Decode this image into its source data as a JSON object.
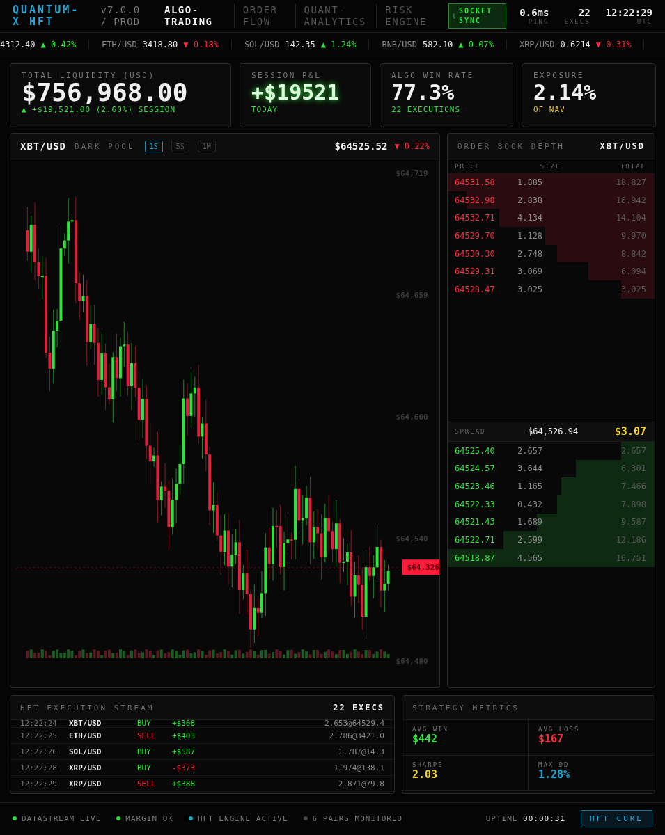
{
  "header": {
    "logo": "QUANTUM-X HFT",
    "version": "v7.0.0 / PROD",
    "tabs": [
      {
        "label": "ALGO-TRADING",
        "selected": true
      },
      {
        "label": "ORDER FLOW",
        "selected": false
      },
      {
        "label": "QUANT-ANALYTICS",
        "selected": false
      },
      {
        "label": "RISK ENGINE",
        "selected": false
      }
    ],
    "sync_button": "SOCKET SYNC",
    "stats": [
      {
        "value": "0.6ms",
        "label": "PING"
      },
      {
        "value": "22",
        "label": "EXECS"
      },
      {
        "value": "12:22:29",
        "label": "UTC"
      }
    ]
  },
  "ticker": [
    {
      "price": "4312.40",
      "change": "▲ 0.42%",
      "kind": "up"
    },
    {
      "pair": "ETH/USD",
      "price": "3418.80",
      "change": "▼ 0.18%",
      "kind": "down"
    },
    {
      "pair": "SOL/USD",
      "price": "142.35",
      "change": "▲ 1.24%",
      "kind": "up"
    },
    {
      "pair": "BNB/USD",
      "price": "582.10",
      "change": "▲ 0.07%",
      "kind": "up"
    },
    {
      "pair": "XRP/USD",
      "price": "0.6214",
      "change": "▼ 0.31%",
      "kind": "down"
    }
  ],
  "stat_cards": [
    {
      "label": "TOTAL LIQUIDITY (USD)",
      "value": "$756,968.00",
      "sub": "▲ +$19,521.00 (2.60%) SESSION",
      "color": "#2ee43a",
      "glow": false
    },
    {
      "label": "SESSION P&L",
      "value": "+$19521",
      "sub": "TODAY",
      "color": "#2ee43a",
      "glow": true
    },
    {
      "label": "ALGO WIN RATE",
      "value": "77.3%",
      "sub": "22 EXECUTIONS",
      "color": "#2ee43a",
      "glow": false
    },
    {
      "label": "EXPOSURE",
      "value": "2.14%",
      "sub": "OF NAV",
      "color": "#e8c425",
      "glow": false
    }
  ],
  "chart_panel": {
    "pair": "XBT/USD",
    "venue": "DARK POOL",
    "timeframes": [
      {
        "label": "1S",
        "selected": true
      },
      {
        "label": "5S",
        "selected": false
      },
      {
        "label": "1M",
        "selected": false
      }
    ],
    "price": "$64525.52",
    "change": "▼ 0.22%",
    "axis_labels": [
      "$64,719",
      "$64,659",
      "$64,600",
      "$64,540",
      "$64,480"
    ],
    "last_price_tag": "$64,326"
  },
  "order_book": {
    "title": "ORDER BOOK DEPTH",
    "pair": "XBT/USD",
    "columns": [
      "PRICE",
      "SIZE",
      "TOTAL"
    ],
    "asks": [
      {
        "price": "64531.58",
        "size": "1.885",
        "total": "18.827"
      },
      {
        "price": "64532.98",
        "size": "2.838",
        "total": "16.942"
      },
      {
        "price": "64532.71",
        "size": "4.134",
        "total": "14.104"
      },
      {
        "price": "64529.70",
        "size": "1.128",
        "total": "9.970"
      },
      {
        "price": "64530.30",
        "size": "2.748",
        "total": "8.842"
      },
      {
        "price": "64529.31",
        "size": "3.069",
        "total": "6.094"
      },
      {
        "price": "64528.47",
        "size": "3.025",
        "total": "3.025"
      }
    ],
    "spread": {
      "label": "SPREAD",
      "mid": "$64,526.94",
      "value": "$3.07"
    },
    "bids": [
      {
        "price": "64525.40",
        "size": "2.657",
        "total": "2.657"
      },
      {
        "price": "64524.57",
        "size": "3.644",
        "total": "6.301"
      },
      {
        "price": "64523.46",
        "size": "1.165",
        "total": "7.466"
      },
      {
        "price": "64522.33",
        "size": "0.432",
        "total": "7.898"
      },
      {
        "price": "64521.43",
        "size": "1.689",
        "total": "9.587"
      },
      {
        "price": "64522.71",
        "size": "2.599",
        "total": "12.186"
      },
      {
        "price": "64518.87",
        "size": "4.565",
        "total": "16.751"
      }
    ]
  },
  "execution_stream": {
    "title": "HFT EXECUTION STREAM",
    "count": "22 EXECS",
    "rows": [
      {
        "time": "12:22:24",
        "pair": "XBT/USD",
        "side": "BUY",
        "kind": "buy",
        "pnl": "+$308",
        "color": "#2ee43a",
        "fill": "2.653@64529.4"
      },
      {
        "time": "12:22:25",
        "pair": "ETH/USD",
        "side": "SELL",
        "kind": "sell",
        "pnl": "+$403",
        "color": "#2ee43a",
        "fill": "2.786@3421.0"
      },
      {
        "time": "12:22:26",
        "pair": "SOL/USD",
        "side": "BUY",
        "kind": "buy",
        "pnl": "+$587",
        "color": "#2ee43a",
        "fill": "1.787@14.3"
      },
      {
        "time": "12:22:28",
        "pair": "XRP/USD",
        "side": "BUY",
        "kind": "buy",
        "pnl": "-$373",
        "color": "#ff2a3a",
        "fill": "1.974@138.1"
      },
      {
        "time": "12:22:29",
        "pair": "XRP/USD",
        "side": "SELL",
        "kind": "sell",
        "pnl": "+$388",
        "color": "#2ee43a",
        "fill": "2.871@79.8"
      }
    ]
  },
  "strategy_metrics": {
    "title": "STRATEGY METRICS",
    "metrics": [
      {
        "label": "AVG WIN",
        "value": "$442",
        "color": "#2ee43a"
      },
      {
        "label": "AVG LOSS",
        "value": "$167",
        "color": "#ff2a3a"
      },
      {
        "label": "SHARPE",
        "value": "2.03",
        "color": "#f2d52a"
      },
      {
        "label": "MAX DD",
        "value": "1.28%",
        "color": "#1aa8d8"
      }
    ]
  },
  "status_bar": {
    "items": [
      {
        "label": "DATASTREAM LIVE",
        "color": "#22dd33"
      },
      {
        "label": "MARGIN OK",
        "color": "#22dd33"
      },
      {
        "label": "HFT ENGINE ACTIVE",
        "color": "#1aa8cc"
      },
      {
        "label": "6 PAIRS MONITORED",
        "color": "#444444"
      }
    ],
    "uptime_label": "UPTIME",
    "uptime": "00:00:31",
    "core_button": "HFT CORE"
  }
}
